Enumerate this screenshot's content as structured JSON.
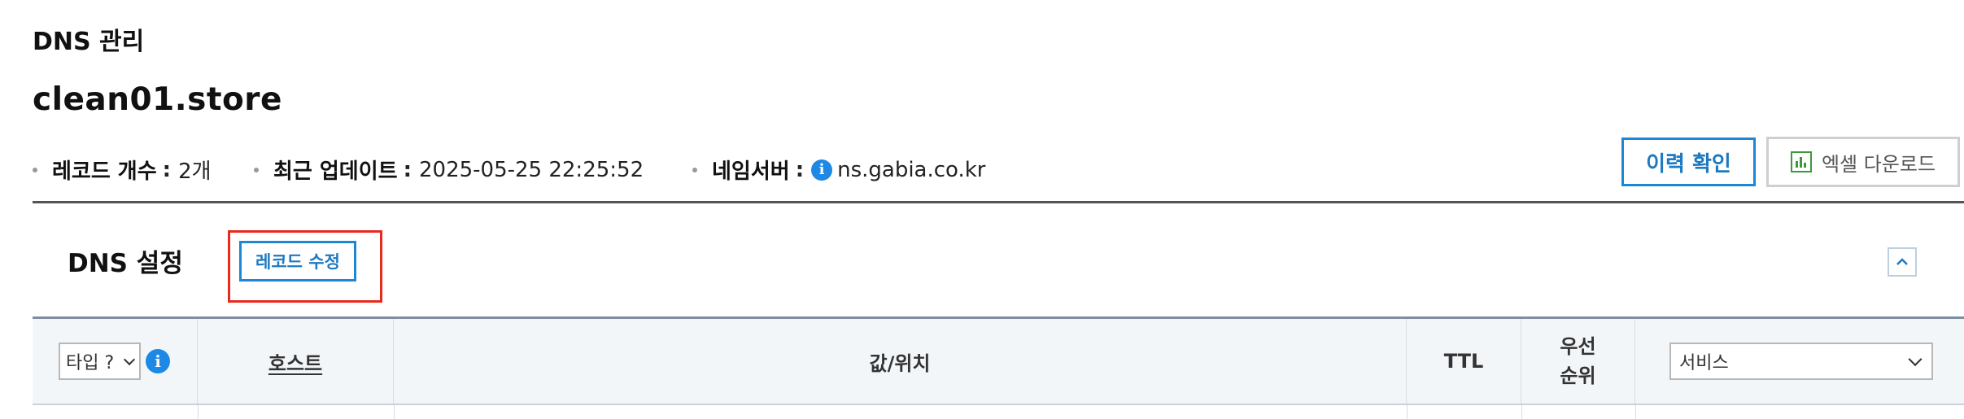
{
  "breadcrumb": "DNS 관리",
  "domain": "clean01.store",
  "meta": {
    "record_count_label": "레코드 개수",
    "record_count_value": "2개",
    "updated_label": "최근 업데이트",
    "updated_value": "2025-05-25 22:25:52",
    "nameserver_label": "네임서버",
    "nameserver_value": "ns.gabia.co.kr",
    "separator": ":"
  },
  "actions": {
    "history_label": "이력 확인",
    "excel_label": "엑셀 다운로드"
  },
  "dns_section": {
    "title": "DNS 설정",
    "edit_record_label": "레코드 수정"
  },
  "table": {
    "type_select_value": "타입 ?",
    "columns": {
      "host": "호스트",
      "value": "값/위치",
      "ttl": "TTL",
      "priority_line1": "우선",
      "priority_line2": "순위"
    },
    "service_select_value": "서비스"
  },
  "icons": {
    "nameserver_info": "info-icon",
    "type_info": "info-icon",
    "excel": "bar-chart-icon",
    "collapse": "chevron-up-icon"
  },
  "colors": {
    "accent_blue": "#1d87d4",
    "highlight_red": "#e8291d",
    "excel_green": "#3a9a3a"
  }
}
